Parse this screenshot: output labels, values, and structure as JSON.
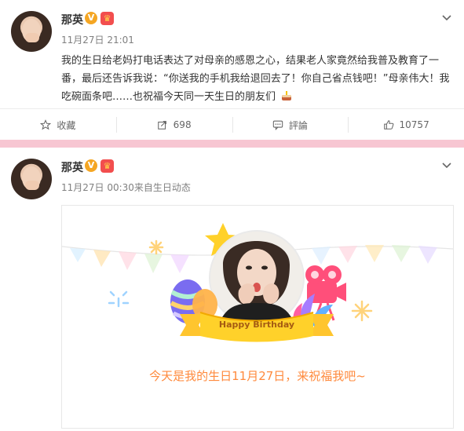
{
  "posts": [
    {
      "name": "那英",
      "time": "11月27日 21:01",
      "text": "我的生日给老妈打电话表达了对母亲的感恩之心，结果老人家竟然给我普及教育了一番，最后还告诉我说：“你送我的手机我给退回去了！你自己省点钱吧！”母亲伟大！我吃碗面条吧……也祝福今天同一天生日的朋友们",
      "badges": {
        "verified": "V",
        "vip": "♛"
      },
      "actions": [
        {
          "icon": "star-icon",
          "label": "收藏"
        },
        {
          "icon": "share-icon",
          "label": "698"
        },
        {
          "icon": "comment-icon",
          "label": "評論"
        },
        {
          "icon": "like-icon",
          "label": "10757"
        }
      ],
      "menu_icon": "chevron-down-icon"
    },
    {
      "name": "那英",
      "time": "11月27日 00:30来自生日动态",
      "badges": {
        "verified": "V",
        "vip": "♛"
      },
      "card": {
        "banner_text": "Happy Birthday",
        "message": "今天是我的生日11月27日，来祝福我吧~"
      },
      "menu_icon": "chevron-down-icon"
    }
  ],
  "colors": {
    "accent": "#ff8a3d",
    "divider": "#f7c6d2",
    "text": "#333333",
    "muted": "#808080"
  }
}
